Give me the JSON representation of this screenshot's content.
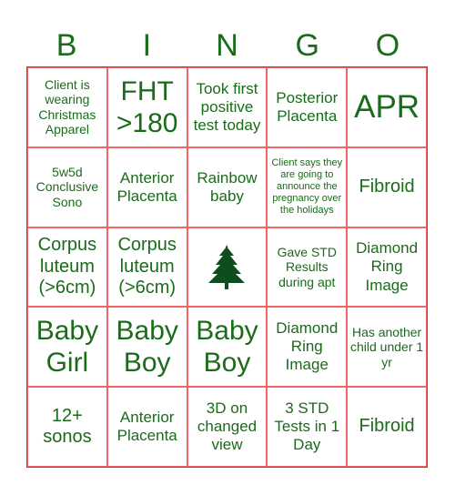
{
  "header": {
    "letters": [
      "B",
      "I",
      "N",
      "G",
      "O"
    ]
  },
  "colors": {
    "text": "#1a6b1a",
    "border": "#e22222",
    "tree": "#0f4d1f"
  },
  "cells": [
    {
      "text": "Client is wearing Christmas Apparel",
      "size": "s2"
    },
    {
      "text": "FHT >180",
      "size": "s5"
    },
    {
      "text": "Took first positive test today",
      "size": "s3"
    },
    {
      "text": "Posterior Placenta",
      "size": "s3"
    },
    {
      "text": "APR",
      "size": "s6"
    },
    {
      "text": "5w5d Conclusive Sono",
      "size": "s2"
    },
    {
      "text": "Anterior Placenta",
      "size": "s3"
    },
    {
      "text": "Rainbow baby",
      "size": "s3"
    },
    {
      "text": "Client says they are going to announce the pregnancy over the holidays",
      "size": "s1"
    },
    {
      "text": "Fibroid",
      "size": "s4"
    },
    {
      "text": "Corpus luteum (>6cm)",
      "size": "s4"
    },
    {
      "text": "Corpus luteum (>6cm)",
      "size": "s4"
    },
    {
      "text": "",
      "size": "free",
      "icon": "christmas-tree-icon"
    },
    {
      "text": "Gave STD Results during apt",
      "size": "s2"
    },
    {
      "text": "Diamond Ring Image",
      "size": "s3"
    },
    {
      "text": "Baby Girl",
      "size": "s5"
    },
    {
      "text": "Baby Boy",
      "size": "s5"
    },
    {
      "text": "Baby Boy",
      "size": "s5"
    },
    {
      "text": "Diamond Ring Image",
      "size": "s3"
    },
    {
      "text": "Has another child under 1 yr",
      "size": "s2"
    },
    {
      "text": "12+ sonos",
      "size": "s4"
    },
    {
      "text": "Anterior Placenta",
      "size": "s3"
    },
    {
      "text": "3D on changed view",
      "size": "s3"
    },
    {
      "text": "3 STD Tests in 1 Day",
      "size": "s3"
    },
    {
      "text": "Fibroid",
      "size": "s4"
    }
  ]
}
